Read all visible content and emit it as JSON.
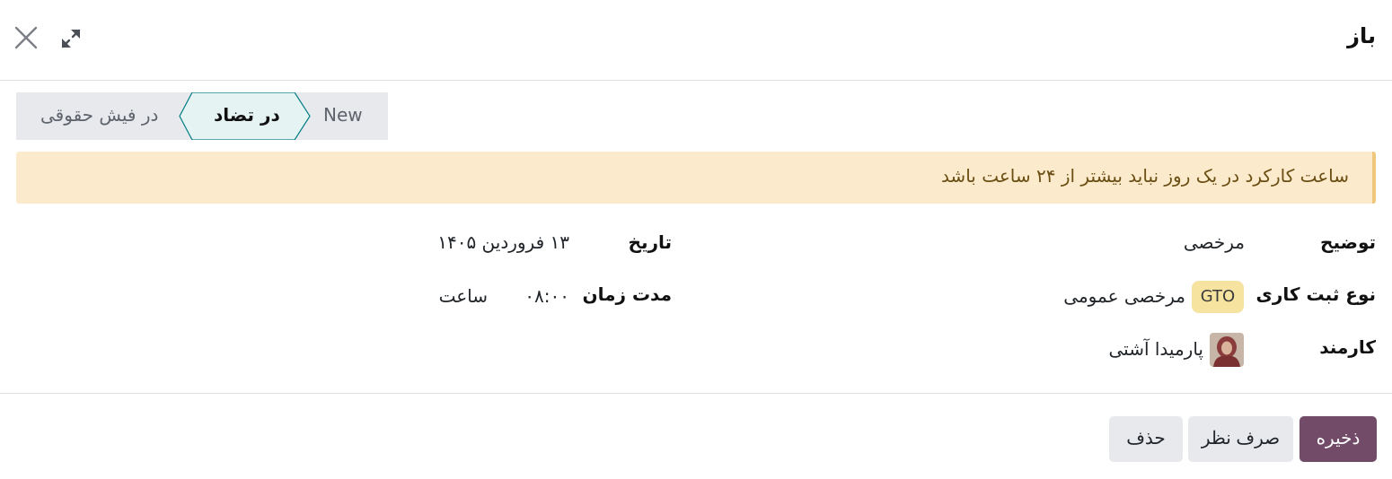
{
  "dialog": {
    "title": "باز"
  },
  "statusbar": {
    "stages": [
      {
        "label": "New",
        "state": "normal"
      },
      {
        "label": "در تضاد",
        "state": "active"
      },
      {
        "label": "در فیش حقوقی",
        "state": "normal"
      }
    ]
  },
  "alert": {
    "message": "ساعت کارکرد در یک روز نباید بیشتر از ۲۴ ساعت باشد"
  },
  "form": {
    "description": {
      "label": "توضیح",
      "value": "مرخصی"
    },
    "work_entry_type": {
      "label": "نوع ثبت کاری",
      "badge": "GTO",
      "value": "مرخصی عمومی"
    },
    "employee": {
      "label": "کارمند",
      "value": "پارمیدا آشتی"
    },
    "date": {
      "label": "تاریخ",
      "value": "۱۳ فروردین ۱۴۰۵"
    },
    "duration": {
      "label": "مدت زمان",
      "value": "۰۸:۰۰",
      "unit": "ساعت"
    }
  },
  "footer": {
    "save_label": "ذخیره",
    "discard_label": "صرف نظر",
    "delete_label": "حذف"
  },
  "colors": {
    "primary": "#714b67",
    "alert_bg": "#fbeacb",
    "alert_text": "#6b4e13",
    "badge_bg": "#f6e3a0",
    "status_active_bg": "#e6f3f3",
    "status_active_border": "#017e84"
  },
  "icons": {
    "close": "close-icon",
    "expand": "expand-icon"
  }
}
